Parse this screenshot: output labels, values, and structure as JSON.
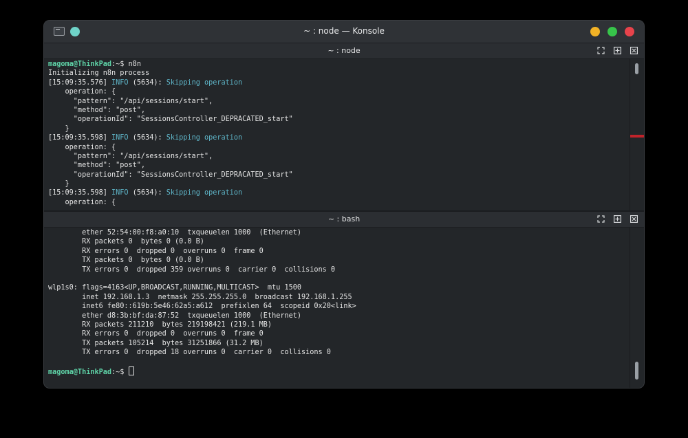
{
  "window": {
    "title": "~ : node — Konsole"
  },
  "top_pane": {
    "title": "~ : node",
    "lines": [
      {
        "parts": [
          {
            "t": "magoma@ThinkPad",
            "c": "prompt"
          },
          {
            "t": ":~$ n8n",
            "c": ""
          }
        ]
      },
      {
        "parts": [
          {
            "t": "Initializing n8n process",
            "c": ""
          }
        ]
      },
      {
        "parts": [
          {
            "t": "[15:09:35.576] ",
            "c": ""
          },
          {
            "t": "INFO",
            "c": "info"
          },
          {
            "t": " (5634): ",
            "c": ""
          },
          {
            "t": "Skipping operation",
            "c": "info"
          }
        ]
      },
      {
        "parts": [
          {
            "t": "    operation: {",
            "c": ""
          }
        ]
      },
      {
        "parts": [
          {
            "t": "      \"pattern\": \"/api/sessions/start\",",
            "c": ""
          }
        ]
      },
      {
        "parts": [
          {
            "t": "      \"method\": \"post\",",
            "c": ""
          }
        ]
      },
      {
        "parts": [
          {
            "t": "      \"operationId\": \"SessionsController_DEPRACATED_start\"",
            "c": ""
          }
        ]
      },
      {
        "parts": [
          {
            "t": "    }",
            "c": ""
          }
        ]
      },
      {
        "parts": [
          {
            "t": "[15:09:35.598] ",
            "c": ""
          },
          {
            "t": "INFO",
            "c": "info"
          },
          {
            "t": " (5634): ",
            "c": ""
          },
          {
            "t": "Skipping operation",
            "c": "info"
          }
        ]
      },
      {
        "parts": [
          {
            "t": "    operation: {",
            "c": ""
          }
        ]
      },
      {
        "parts": [
          {
            "t": "      \"pattern\": \"/api/sessions/start\",",
            "c": ""
          }
        ]
      },
      {
        "parts": [
          {
            "t": "      \"method\": \"post\",",
            "c": ""
          }
        ]
      },
      {
        "parts": [
          {
            "t": "      \"operationId\": \"SessionsController_DEPRACATED_start\"",
            "c": ""
          }
        ]
      },
      {
        "parts": [
          {
            "t": "    }",
            "c": ""
          }
        ]
      },
      {
        "parts": [
          {
            "t": "[15:09:35.598] ",
            "c": ""
          },
          {
            "t": "INFO",
            "c": "info"
          },
          {
            "t": " (5634): ",
            "c": ""
          },
          {
            "t": "Skipping operation",
            "c": "info"
          }
        ]
      },
      {
        "parts": [
          {
            "t": "    operation: {",
            "c": ""
          }
        ]
      }
    ]
  },
  "bottom_pane": {
    "title": "~ : bash",
    "lines": [
      {
        "parts": [
          {
            "t": "        ether 52:54:00:f8:a0:10  txqueuelen 1000  (Ethernet)",
            "c": ""
          }
        ]
      },
      {
        "parts": [
          {
            "t": "        RX packets 0  bytes 0 (0.0 B)",
            "c": ""
          }
        ]
      },
      {
        "parts": [
          {
            "t": "        RX errors 0  dropped 0  overruns 0  frame 0",
            "c": ""
          }
        ]
      },
      {
        "parts": [
          {
            "t": "        TX packets 0  bytes 0 (0.0 B)",
            "c": ""
          }
        ]
      },
      {
        "parts": [
          {
            "t": "        TX errors 0  dropped 359 overruns 0  carrier 0  collisions 0",
            "c": ""
          }
        ]
      },
      {
        "parts": [
          {
            "t": "",
            "c": ""
          }
        ]
      },
      {
        "parts": [
          {
            "t": "wlp1s0: flags=4163<UP,BROADCAST,RUNNING,MULTICAST>  mtu 1500",
            "c": ""
          }
        ]
      },
      {
        "parts": [
          {
            "t": "        inet 192.168.1.3  netmask 255.255.255.0  broadcast 192.168.1.255",
            "c": ""
          }
        ]
      },
      {
        "parts": [
          {
            "t": "        inet6 fe80::619b:5e46:62a5:a612  prefixlen 64  scopeid 0x20<link>",
            "c": ""
          }
        ]
      },
      {
        "parts": [
          {
            "t": "        ether d8:3b:bf:da:87:52  txqueuelen 1000  (Ethernet)",
            "c": ""
          }
        ]
      },
      {
        "parts": [
          {
            "t": "        RX packets 211210  bytes 219198421 (219.1 MB)",
            "c": ""
          }
        ]
      },
      {
        "parts": [
          {
            "t": "        RX errors 0  dropped 0  overruns 0  frame 0",
            "c": ""
          }
        ]
      },
      {
        "parts": [
          {
            "t": "        TX packets 105214  bytes 31251866 (31.2 MB)",
            "c": ""
          }
        ]
      },
      {
        "parts": [
          {
            "t": "        TX errors 0  dropped 18 overruns 0  carrier 0  collisions 0",
            "c": ""
          }
        ]
      },
      {
        "parts": [
          {
            "t": "",
            "c": ""
          }
        ]
      },
      {
        "parts": [
          {
            "t": "magoma@ThinkPad",
            "c": "prompt"
          },
          {
            "t": ":~$ ",
            "c": ""
          }
        ]
      }
    ]
  },
  "icons": {
    "app": "konsole-app-icon",
    "pin": "pin-dot-icon",
    "expand": "expand-icon",
    "split": "split-view-icon",
    "close_pane": "close-pane-icon"
  },
  "colors": {
    "prompt": "#5fd4a8",
    "info": "#5fb6c9",
    "minimize": "#f2b226",
    "maximize": "#37c44a",
    "close": "#e7434b",
    "pin": "#6fd3c8",
    "scroll_marker": "#c0232a"
  }
}
